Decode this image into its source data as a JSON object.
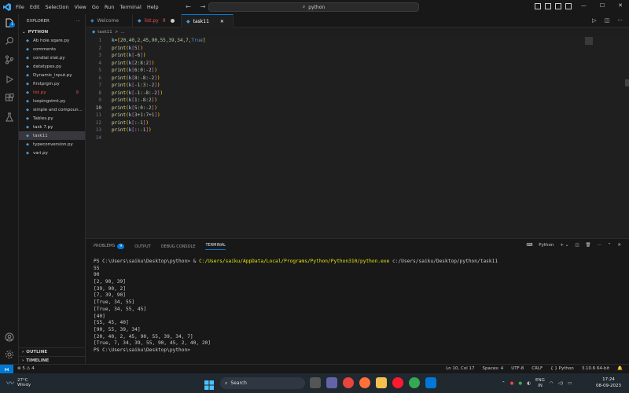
{
  "titlebar": {
    "menu": [
      "File",
      "Edit",
      "Selection",
      "View",
      "Go",
      "Run",
      "Terminal",
      "Help"
    ],
    "search_text": "python"
  },
  "sidebar": {
    "title": "EXPLORER",
    "more": "···",
    "folder": "PYTHON",
    "files": [
      {
        "name": "Ab hole sqare.py"
      },
      {
        "name": "comments"
      },
      {
        "name": "condial stat.py"
      },
      {
        "name": "datatypes.py"
      },
      {
        "name": "Dynamic_input.py"
      },
      {
        "name": "firstprgm.py"
      },
      {
        "name": "list.py",
        "error": "9"
      },
      {
        "name": "loopingstmt.py"
      },
      {
        "name": "simple and compoun..."
      },
      {
        "name": "Tables.py"
      },
      {
        "name": "task 7.py"
      },
      {
        "name": "task11"
      },
      {
        "name": "typeconversion.py"
      },
      {
        "name": "vari.py"
      }
    ],
    "outline": "OUTLINE",
    "timeline": "TIMELINE"
  },
  "tabs": [
    {
      "label": "Welcome"
    },
    {
      "label": "list.py",
      "badge": "9"
    },
    {
      "label": "task11"
    }
  ],
  "breadcrumb": {
    "file": "task11",
    "sep": ">",
    "rest": "..."
  },
  "editor": {
    "lines": [
      "k=[20,40,2,45,90,55,39,34,7,True]",
      "print(k[5])",
      "print(k[-6])",
      "print(k[2:8:2])",
      "print(k[6:0:-2])",
      "print(k[8:-8:-2])",
      "print(k[-1:3:-2])",
      "print(k[-1:-8:-2])",
      "print(k[1:-8:2])",
      "print(k[5:0:-2])",
      "print(k[3+1:7+1])",
      "print(k[:-1])",
      "print(k[::-1])",
      ""
    ],
    "current_line": 10
  },
  "panel": {
    "tabs": [
      "PROBLEMS",
      "OUTPUT",
      "DEBUG CONSOLE",
      "TERMINAL"
    ],
    "problems_count": "9",
    "terminal_label": "Python",
    "terminal": {
      "prompt": "PS C:\\Users\\saiku\\Desktop\\python> & ",
      "exe": "C:/Users/saiku/AppData/Local/Programs/Python/Python310/python.exe",
      "arg": " c:/Users/saiku/Desktop/python/task11",
      "output": [
        "55",
        "90",
        "[2, 90, 39]",
        "[39, 90, 2]",
        "[7, 39, 90]",
        "[True, 34, 55]",
        "[True, 34, 55, 45]",
        "[40]",
        "[55, 45, 40]",
        "[90, 55, 39, 34]",
        "[20, 40, 2, 45, 90, 55, 39, 34, 7]",
        "[True, 7, 34, 39, 55, 90, 45, 2, 40, 20]",
        "PS C:\\Users\\saiku\\Desktop\\python>"
      ]
    }
  },
  "statusbar": {
    "problems": "⊗ 5 ⚠ 4",
    "position": "Ln 10, Col 17",
    "spaces": "Spaces: 4",
    "encoding": "UTF-8",
    "eol": "CRLF",
    "language": "Python",
    "interpreter": "3.10.6 64-bit"
  },
  "taskbar": {
    "temperature": "27°C",
    "weather": "Windy",
    "search": "Search",
    "lang1": "ENG",
    "lang2": "IN",
    "time": "17:24",
    "date": "08-09-2023"
  },
  "colors": {
    "accent": "#0078d4",
    "error": "#f14c4c"
  }
}
